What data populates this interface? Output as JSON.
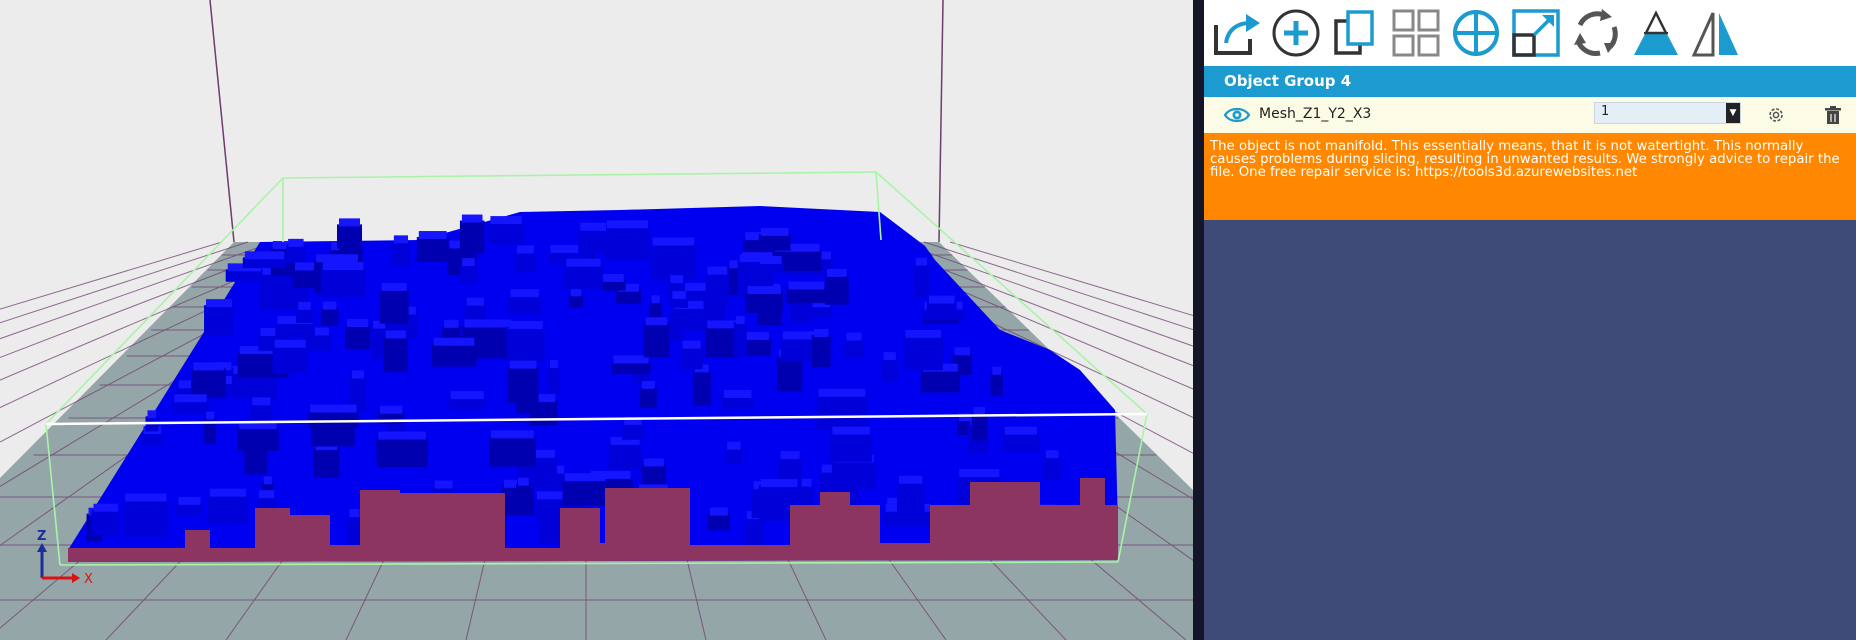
{
  "viewport": {
    "axis_z": "Z",
    "axis_x": "X",
    "colors": {
      "background": "#ececec",
      "bed": "#95a6a8",
      "grid_line": "#6e3c6e",
      "model": "#0000f0",
      "model_side": "#8c3560",
      "bounding_box": "#a7f4a7"
    }
  },
  "toolbar": {
    "tools": [
      {
        "name": "share-icon"
      },
      {
        "name": "add-icon"
      },
      {
        "name": "copy-icon"
      },
      {
        "name": "arrange-icon"
      },
      {
        "name": "move-icon"
      },
      {
        "name": "scale-icon"
      },
      {
        "name": "rotate-icon"
      },
      {
        "name": "cut-icon"
      },
      {
        "name": "mirror-icon"
      }
    ]
  },
  "object_panel": {
    "group_title": "Object Group 4",
    "object": {
      "name": "Mesh_Z1_Y2_X3",
      "copies": "1",
      "visible": true
    },
    "warning": "The object is not manifold. This essentially means, that it is not watertight. This normally causes problems during slicing, resulting in unwanted results. We strongly advice to repair the file. One free repair service is: https://tools3d.azurewebsites.net"
  },
  "colors": {
    "accent": "#1b9bd0",
    "warning": "#ff8800",
    "panel_bg": "#3e4a78",
    "row_bg": "#fbfbe6"
  }
}
